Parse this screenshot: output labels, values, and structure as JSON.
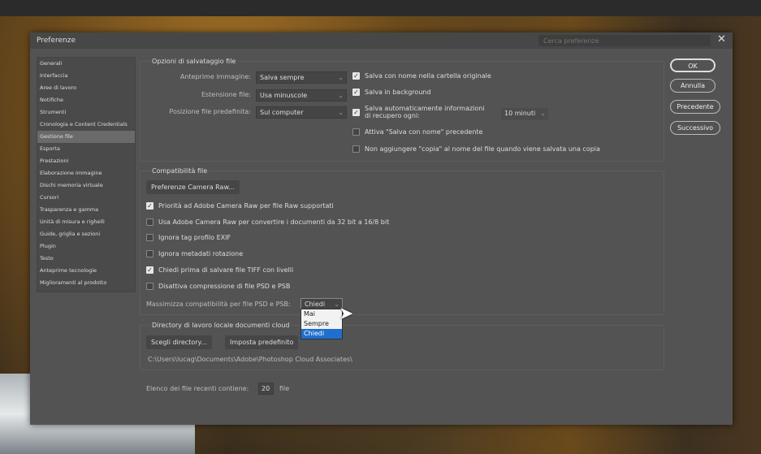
{
  "dialog": {
    "title": "Preferenze",
    "search_placeholder": "Cerca preferenze",
    "close": "✕"
  },
  "sidebar": {
    "items": [
      "Generali",
      "Interfaccia",
      "Aree di lavoro",
      "Notifiche",
      "Strumenti",
      "Cronologia e Content Credentials",
      "Gestione file",
      "Esporta",
      "Prestazioni",
      "Elaborazione immagine",
      "Dischi memoria virtuale",
      "Cursori",
      "Trasparenza e gamma",
      "Unità di misura e righelli",
      "Guide, griglia e sezioni",
      "Plugin",
      "Testo",
      "Anteprime tecnologie",
      "Miglioramenti al prodotto"
    ],
    "selected": "Gestione file"
  },
  "buttons": {
    "ok": "OK",
    "cancel": "Annulla",
    "prev": "Precedente",
    "next": "Successivo"
  },
  "save_options": {
    "title": "Opzioni di salvataggio file",
    "image_preview_label": "Anteprime immagine:",
    "image_preview_value": "Salva sempre",
    "extension_label": "Estensione file:",
    "extension_value": "Usa minuscole",
    "location_label": "Posizione file predefinita:",
    "location_value": "Sul computer",
    "cb_save_as_original": {
      "label": "Salva con nome nella cartella originale",
      "checked": true
    },
    "cb_background": {
      "label": "Salva in background",
      "checked": true
    },
    "cb_autosave": {
      "label1": "Salva automaticamente informazioni",
      "label2": "di recupero ogni:",
      "checked": true
    },
    "autosave_interval": "10 minuti",
    "cb_legacy_save_as": {
      "label": "Attiva \"Salva con nome\" precedente",
      "checked": false
    },
    "cb_no_copy": {
      "label": "Non aggiungere \"copia\" al nome del file quando viene salvata una copia",
      "checked": false
    }
  },
  "compat": {
    "title": "Compatibilità file",
    "camera_raw_button": "Preferenze Camera Raw...",
    "options": [
      {
        "label": "Priorità ad Adobe Camera Raw per file Raw supportati",
        "checked": true
      },
      {
        "label": "Usa Adobe Camera Raw per convertire i documenti da 32 bit a 16/8 bit",
        "checked": false
      },
      {
        "label": "Ignora tag profilo EXIF",
        "checked": false
      },
      {
        "label": "Ignora metadati rotazione",
        "checked": false
      },
      {
        "label": "Chiedi prima di salvare file TIFF con livelli",
        "checked": true
      },
      {
        "label": "Disattiva compressione di file PSD e PSB",
        "checked": false
      }
    ],
    "maximize_label": "Massimizza compatibilità per file PSD e PSB:",
    "maximize_value": "Chiedi",
    "maximize_options": [
      "Mai",
      "Sempre",
      "Chiedi"
    ]
  },
  "cloud": {
    "title": "Directory di lavoro locale documenti cloud",
    "choose_button": "Scegli directory...",
    "default_button": "Imposta predefinito",
    "path": "C:\\Users\\lucag\\Documents\\Adobe\\Photoshop Cloud Associates\\"
  },
  "recent": {
    "label": "Elenco dei file recenti contiene:",
    "value": "20",
    "unit": "file"
  }
}
